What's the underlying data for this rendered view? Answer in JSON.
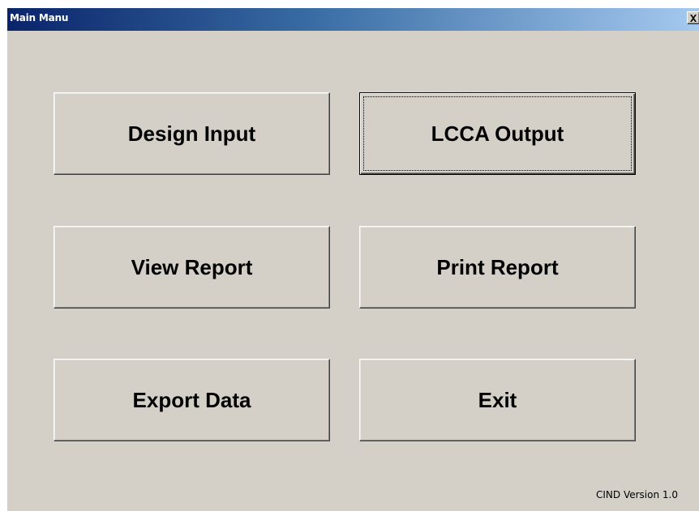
{
  "window": {
    "title": "Main Manu",
    "close_label": "x"
  },
  "buttons": {
    "design_input": "Design Input",
    "lcca_output": "LCCA Output",
    "view_report": "View Report",
    "print_report": "Print Report",
    "export_data": "Export Data",
    "exit": "Exit"
  },
  "footer": {
    "version": "CIND Version 1.0"
  },
  "colors": {
    "face": "#d4d0c8",
    "titlebar_start": "#0a246a",
    "titlebar_end": "#a6caf0"
  }
}
